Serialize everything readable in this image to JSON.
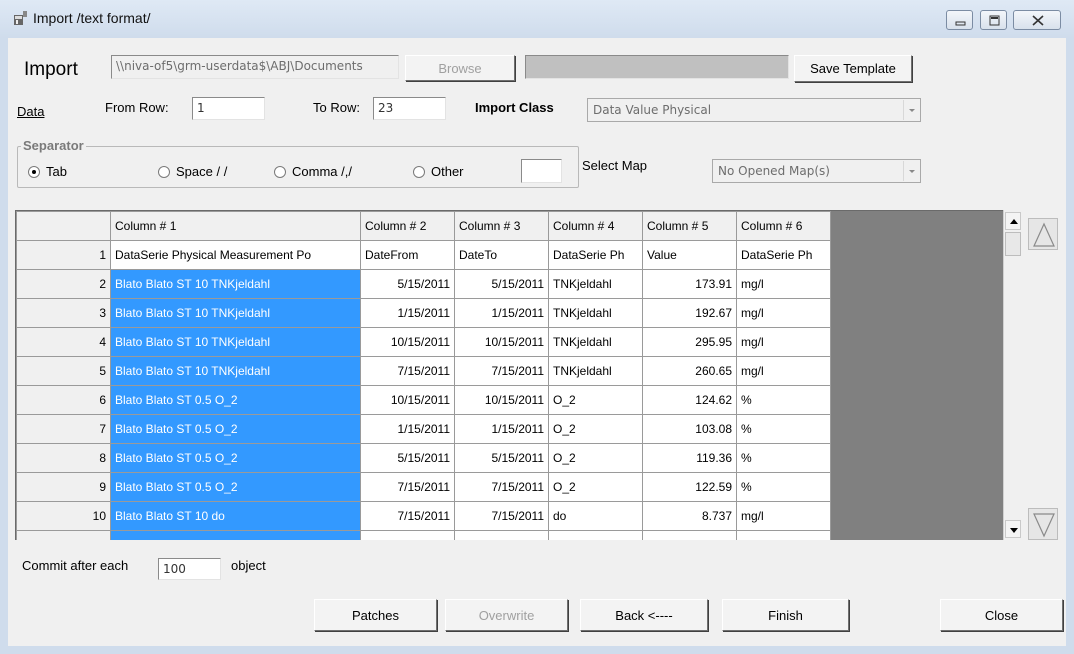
{
  "window": {
    "title": "Import /text format/"
  },
  "header": {
    "import_label": "Import",
    "path_value": "\\\\niva-of5\\grm-userdata$\\ABJ\\Documents",
    "browse_label": "Browse",
    "save_template_label": "Save Template"
  },
  "data_row": {
    "data_label": "Data",
    "from_row_label": "From Row:",
    "from_row_value": "1",
    "to_row_label": "To Row:",
    "to_row_value": "23",
    "import_class_label": "Import Class",
    "import_class_value": "Data Value Physical"
  },
  "separator": {
    "title": "Separator",
    "options": [
      "Tab",
      "Space / /",
      "Comma /,/",
      "Other"
    ],
    "selected": "Tab",
    "select_map_label": "Select Map",
    "map_value": "No Opened Map(s)"
  },
  "grid": {
    "columns": [
      "",
      "Column # 1",
      "Column # 2",
      "Column # 3",
      "Column # 4",
      "Column # 5",
      "Column # 6"
    ],
    "rows": [
      [
        "1",
        "DataSerie Physical Measurement Po",
        "DateFrom",
        "DateTo",
        "DataSerie Ph",
        "Value",
        "DataSerie Ph"
      ],
      [
        "2",
        "Blato Blato ST 10 TNKjeldahl",
        "5/15/2011",
        "5/15/2011",
        "TNKjeldahl",
        "173.91",
        "mg/l"
      ],
      [
        "3",
        "Blato Blato ST 10 TNKjeldahl",
        "1/15/2011",
        "1/15/2011",
        "TNKjeldahl",
        "192.67",
        "mg/l"
      ],
      [
        "4",
        "Blato Blato ST 10 TNKjeldahl",
        "10/15/2011",
        "10/15/2011",
        "TNKjeldahl",
        "295.95",
        "mg/l"
      ],
      [
        "5",
        "Blato Blato ST 10 TNKjeldahl",
        "7/15/2011",
        "7/15/2011",
        "TNKjeldahl",
        "260.65",
        "mg/l"
      ],
      [
        "6",
        "Blato Blato ST 0.5 O_2",
        "10/15/2011",
        "10/15/2011",
        "O_2",
        "124.62",
        "%"
      ],
      [
        "7",
        "Blato Blato ST 0.5 O_2",
        "1/15/2011",
        "1/15/2011",
        "O_2",
        "103.08",
        "%"
      ],
      [
        "8",
        "Blato Blato ST 0.5 O_2",
        "5/15/2011",
        "5/15/2011",
        "O_2",
        "119.36",
        "%"
      ],
      [
        "9",
        "Blato Blato ST 0.5 O_2",
        "7/15/2011",
        "7/15/2011",
        "O_2",
        "122.59",
        "%"
      ],
      [
        "10",
        "Blato Blato ST 10 do",
        "7/15/2011",
        "7/15/2011",
        "do",
        "8.737",
        "mg/l"
      ]
    ]
  },
  "commit": {
    "prefix": "Commit after each",
    "value": "100",
    "suffix": "object"
  },
  "buttons": {
    "patches": "Patches",
    "overwrite": "Overwrite",
    "back": "Back <----",
    "finish": "Finish",
    "close": "Close"
  }
}
